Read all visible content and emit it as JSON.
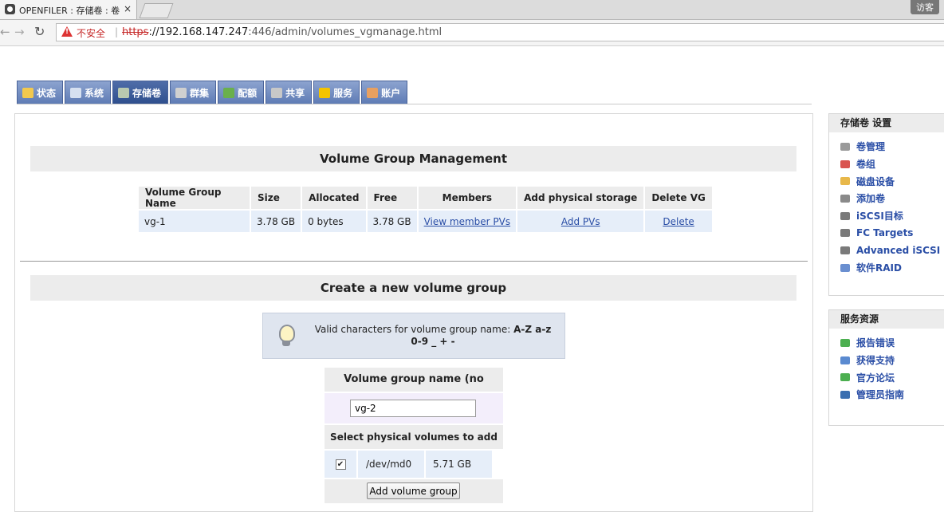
{
  "browser": {
    "tab_title": "OPENFILER : 存储卷 : 卷",
    "tab_close": "×",
    "visitor_label": "访客",
    "security_label": "不安全",
    "url_proto": "https",
    "url_rest_host": "://192.168.147.247",
    "url_rest_path": ":446/admin/volumes_vgmanage.html"
  },
  "nav": {
    "tabs": [
      {
        "label": "状态",
        "icon": "status-icon",
        "color": "#f3c94e"
      },
      {
        "label": "系统",
        "icon": "system-icon",
        "color": "#d6e0f0"
      },
      {
        "label": "存储卷",
        "icon": "volume-icon",
        "color": "#b9c9b0",
        "active": true
      },
      {
        "label": "群集",
        "icon": "cluster-icon",
        "color": "#d0d0d0"
      },
      {
        "label": "配额",
        "icon": "quota-icon",
        "color": "#6ab04c"
      },
      {
        "label": "共享",
        "icon": "share-icon",
        "color": "#c8c8c8"
      },
      {
        "label": "服务",
        "icon": "service-icon",
        "color": "#f5c400"
      },
      {
        "label": "账户",
        "icon": "account-icon",
        "color": "#e8a060"
      }
    ]
  },
  "vg_management": {
    "title": "Volume Group Management",
    "headers": [
      "Volume Group Name",
      "Size",
      "Allocated",
      "Free",
      "Members",
      "Add physical storage",
      "Delete VG"
    ],
    "rows": [
      {
        "name": "vg-1",
        "size": "3.78 GB",
        "allocated": "0 bytes",
        "free": "3.78 GB",
        "members_link": "View member PVs",
        "add_link": "Add PVs",
        "delete_link": "Delete"
      }
    ]
  },
  "create_vg": {
    "title": "Create a new volume group",
    "tip_text": "Valid characters for volume group name: ",
    "tip_chars": "A-Z a-z 0-9 _ + -",
    "name_header": "Volume group name (no spaces)",
    "name_value": "vg-2",
    "pv_header": "Select physical volumes to add",
    "pvs": [
      {
        "checked": true,
        "device": "/dev/md0",
        "size": "5.71 GB"
      }
    ],
    "submit_label": "Add volume group"
  },
  "sidebar": {
    "volume_settings": {
      "title": "存储卷 设置",
      "items": [
        {
          "label": "卷管理",
          "icon": "disk-icon",
          "color": "#9a9a9a"
        },
        {
          "label": "卷组",
          "icon": "pie-icon",
          "color": "#d9534f"
        },
        {
          "label": "磁盘设备",
          "icon": "disk-device-icon",
          "color": "#e8b84a"
        },
        {
          "label": "添加卷",
          "icon": "add-volume-icon",
          "color": "#8a8a8a"
        },
        {
          "label": "iSCSI目标",
          "icon": "iscsi-icon",
          "color": "#7a7a7a"
        },
        {
          "label": "FC Targets",
          "icon": "fc-icon",
          "color": "#7a7a7a"
        },
        {
          "label": "Advanced iSCSI",
          "icon": "advanced-iscsi-icon",
          "color": "#7a7a7a"
        },
        {
          "label": "软件RAID",
          "icon": "raid-icon",
          "color": "#6a8fd0"
        }
      ]
    },
    "service_resources": {
      "title": "服务资源",
      "items": [
        {
          "label": "报告错误",
          "icon": "bug-icon",
          "color": "#4caf50"
        },
        {
          "label": "获得支持",
          "icon": "support-icon",
          "color": "#5a8ad0"
        },
        {
          "label": "官方论坛",
          "icon": "forum-icon",
          "color": "#4caf50"
        },
        {
          "label": "管理员指南",
          "icon": "guide-icon",
          "color": "#3a6fb0"
        }
      ]
    }
  }
}
